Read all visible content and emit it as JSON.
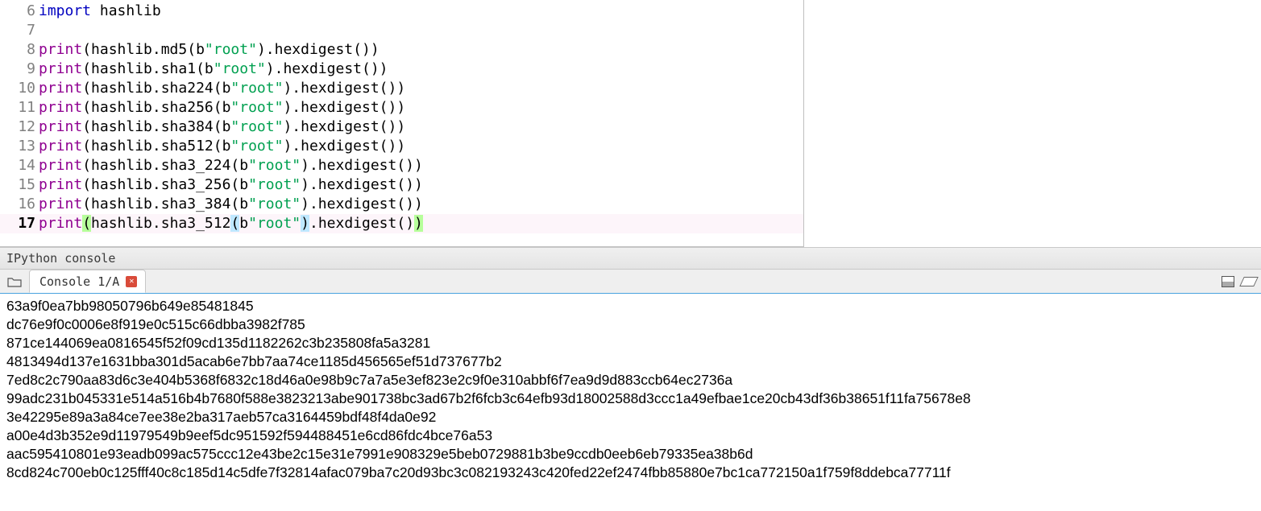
{
  "editor": {
    "lines": [
      {
        "num": "6",
        "tokens": [
          {
            "t": "import ",
            "c": "kw-import"
          },
          {
            "t": "hashlib",
            "c": ""
          }
        ]
      },
      {
        "num": "7",
        "tokens": []
      },
      {
        "num": "8",
        "tokens": [
          {
            "t": "print",
            "c": "builtin"
          },
          {
            "t": "(hashlib.md5(b",
            "c": ""
          },
          {
            "t": "\"root\"",
            "c": "bytes"
          },
          {
            "t": ").hexdigest())",
            "c": ""
          }
        ]
      },
      {
        "num": "9",
        "tokens": [
          {
            "t": "print",
            "c": "builtin"
          },
          {
            "t": "(hashlib.sha1(b",
            "c": ""
          },
          {
            "t": "\"root\"",
            "c": "bytes"
          },
          {
            "t": ").hexdigest())",
            "c": ""
          }
        ]
      },
      {
        "num": "10",
        "tokens": [
          {
            "t": "print",
            "c": "builtin"
          },
          {
            "t": "(hashlib.sha224(b",
            "c": ""
          },
          {
            "t": "\"root\"",
            "c": "bytes"
          },
          {
            "t": ").hexdigest())",
            "c": ""
          }
        ]
      },
      {
        "num": "11",
        "tokens": [
          {
            "t": "print",
            "c": "builtin"
          },
          {
            "t": "(hashlib.sha256(b",
            "c": ""
          },
          {
            "t": "\"root\"",
            "c": "bytes"
          },
          {
            "t": ").hexdigest())",
            "c": ""
          }
        ]
      },
      {
        "num": "12",
        "tokens": [
          {
            "t": "print",
            "c": "builtin"
          },
          {
            "t": "(hashlib.sha384(b",
            "c": ""
          },
          {
            "t": "\"root\"",
            "c": "bytes"
          },
          {
            "t": ").hexdigest())",
            "c": ""
          }
        ]
      },
      {
        "num": "13",
        "tokens": [
          {
            "t": "print",
            "c": "builtin"
          },
          {
            "t": "(hashlib.sha512(b",
            "c": ""
          },
          {
            "t": "\"root\"",
            "c": "bytes"
          },
          {
            "t": ").hexdigest())",
            "c": ""
          }
        ]
      },
      {
        "num": "14",
        "tokens": [
          {
            "t": "print",
            "c": "builtin"
          },
          {
            "t": "(hashlib.sha3_224(b",
            "c": ""
          },
          {
            "t": "\"root\"",
            "c": "bytes"
          },
          {
            "t": ").hexdigest())",
            "c": ""
          }
        ]
      },
      {
        "num": "15",
        "tokens": [
          {
            "t": "print",
            "c": "builtin"
          },
          {
            "t": "(hashlib.sha3_256(b",
            "c": ""
          },
          {
            "t": "\"root\"",
            "c": "bytes"
          },
          {
            "t": ").hexdigest())",
            "c": ""
          }
        ]
      },
      {
        "num": "16",
        "tokens": [
          {
            "t": "print",
            "c": "builtin"
          },
          {
            "t": "(hashlib.sha3_384(b",
            "c": ""
          },
          {
            "t": "\"root\"",
            "c": "bytes"
          },
          {
            "t": ").hexdigest())",
            "c": ""
          }
        ]
      },
      {
        "num": "17",
        "current": true,
        "tokens": [
          {
            "t": "print",
            "c": "builtin"
          },
          {
            "t": "(",
            "c": "paren-hl-y"
          },
          {
            "t": "hashlib.sha3_512",
            "c": ""
          },
          {
            "t": "(",
            "c": "paren-hl-b"
          },
          {
            "t": "b",
            "c": ""
          },
          {
            "t": "\"root\"",
            "c": "bytes"
          },
          {
            "t": ")",
            "c": "paren-hl-b"
          },
          {
            "t": ".hexdigest()",
            "c": ""
          },
          {
            "t": ")",
            "c": "paren-hl-y"
          }
        ]
      }
    ]
  },
  "console_panel": {
    "title": "IPython console",
    "tab_label": "Console 1/A"
  },
  "console_output": [
    "63a9f0ea7bb98050796b649e85481845",
    "dc76e9f0c0006e8f919e0c515c66dbba3982f785",
    "871ce144069ea0816545f52f09cd135d1182262c3b235808fa5a3281",
    "4813494d137e1631bba301d5acab6e7bb7aa74ce1185d456565ef51d737677b2",
    "7ed8c2c790aa83d6c3e404b5368f6832c18d46a0e98b9c7a7a5e3ef823e2c9f0e310abbf6f7ea9d9d883ccb64ec2736a",
    "99adc231b045331e514a516b4b7680f588e3823213abe901738bc3ad67b2f6fcb3c64efb93d18002588d3ccc1a49efbae1ce20cb43df36b38651f11fa75678e8",
    "3e42295e89a3a84ce7ee38e2ba317aeb57ca3164459bdf48f4da0e92",
    "a00e4d3b352e9d11979549b9eef5dc951592f594488451e6cd86fdc4bce76a53",
    "aac595410801e93eadb099ac575ccc12e43be2c15e31e7991e908329e5beb0729881b3be9ccdb0eeb6eb79335ea38b6d",
    "8cd824c700eb0c125fff40c8c185d14c5dfe7f32814afac079ba7c20d93bc3c082193243c420fed22ef2474fbb85880e7bc1ca772150a1f759f8ddebca77711f"
  ]
}
